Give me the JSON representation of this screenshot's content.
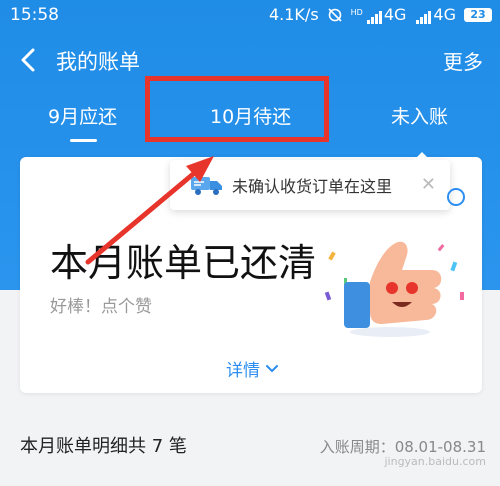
{
  "status_bar": {
    "time": "15:58",
    "network_speed": "4.1K/s",
    "signal1_label": "4G",
    "signal2_label": "4G",
    "hd_label": "HD",
    "battery": "23"
  },
  "header": {
    "back_icon": "chevron-left-icon",
    "title": "我的账单",
    "more_label": "更多"
  },
  "tabs": [
    {
      "label": "9月应还",
      "active": true
    },
    {
      "label": "10月待还",
      "active": false
    },
    {
      "label": "未入账",
      "active": false
    }
  ],
  "tooltip": {
    "icon": "delivery-truck-icon",
    "text": "未确认收货订单在这里",
    "close_icon": "close-icon"
  },
  "bill_card": {
    "status_title": "本月账单已还清",
    "subtitle": "好棒！点个赞",
    "details_label": "详情",
    "details_icon": "chevron-down-icon",
    "illustration": "thumbs-up-icon"
  },
  "summary": {
    "label": "本月账单明细共 7 笔",
    "cycle_label": "入账周期：08.01-08.31"
  },
  "watermark": "jingyan.baidu.com",
  "colors": {
    "primary_blue": "#1f8ce6",
    "annotation_red": "#e8352c",
    "link_blue": "#2b8ef0"
  }
}
